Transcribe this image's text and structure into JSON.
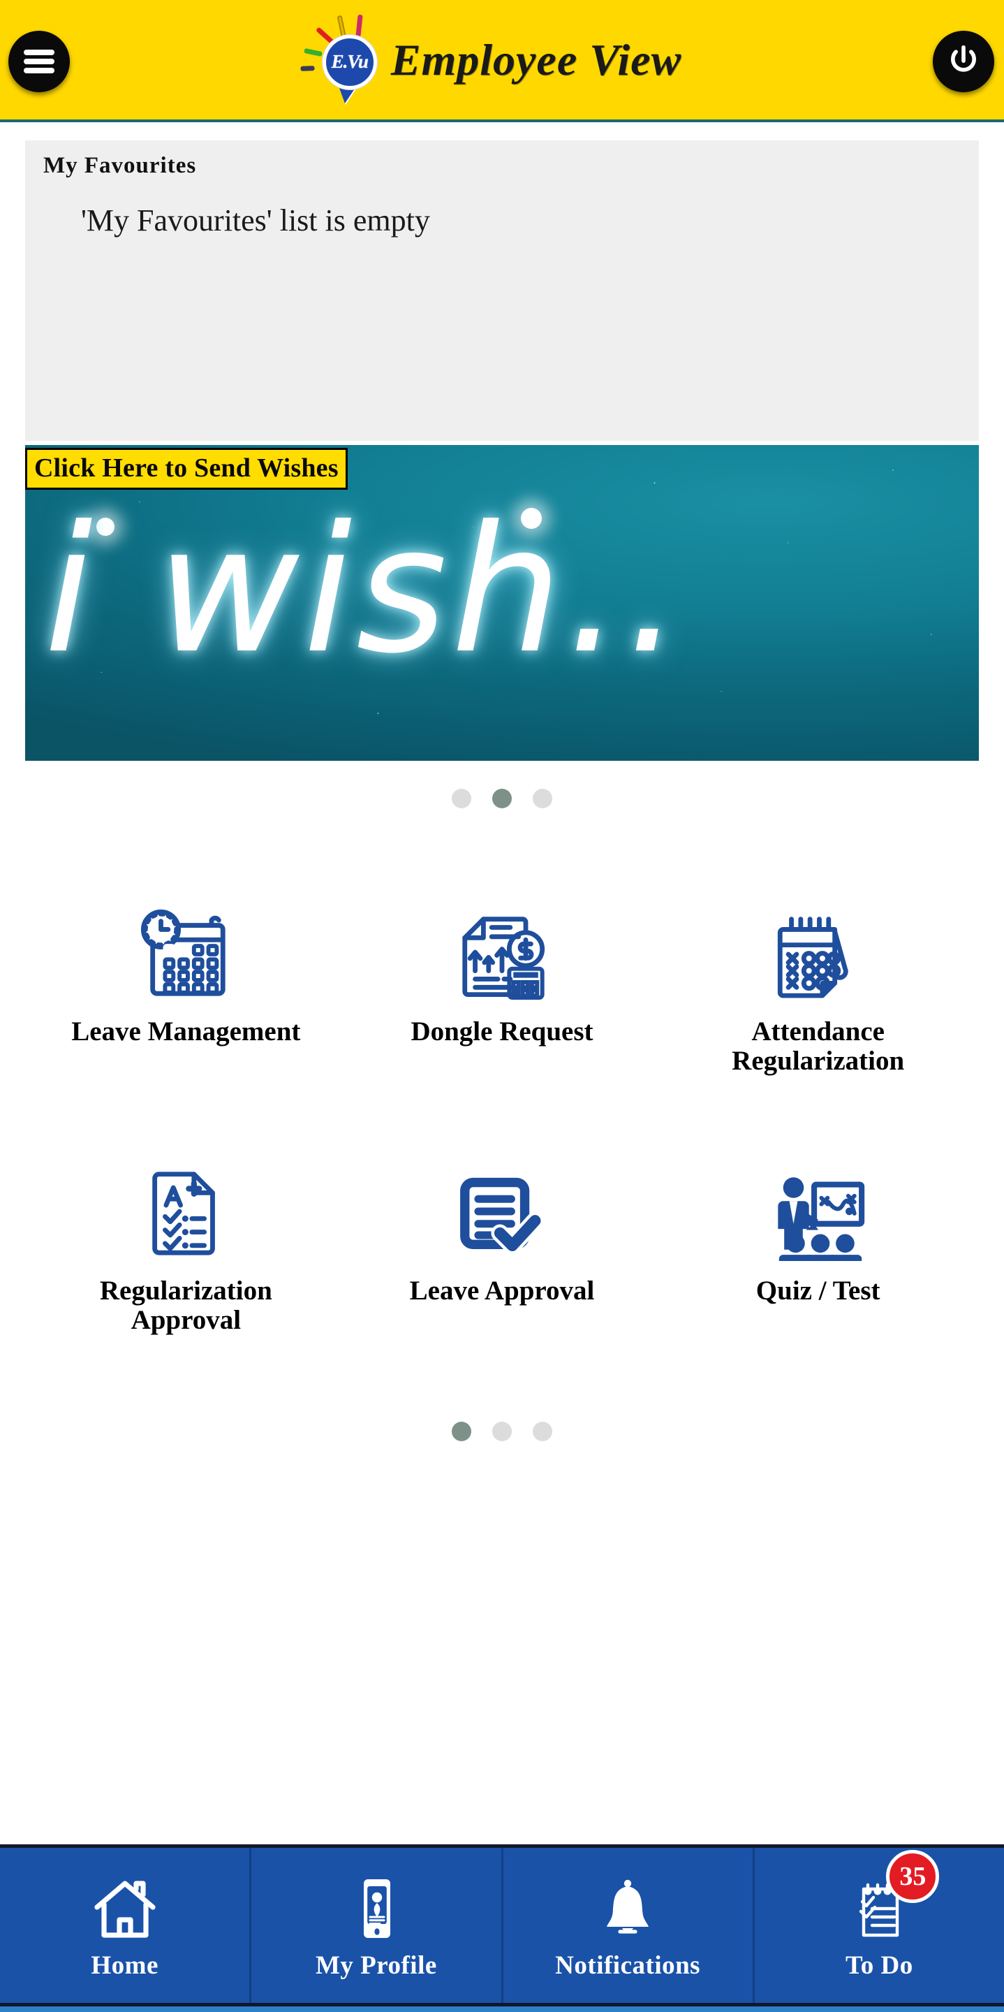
{
  "header": {
    "title": "Employee View",
    "logo_text": "E.Vu",
    "menu_icon": "hamburger-menu-icon",
    "power_icon": "power-icon",
    "bg_color": "#FFD800"
  },
  "favourites": {
    "title": "My Favourites",
    "empty_message": "'My Favourites' list is empty"
  },
  "wishes_banner": {
    "button_label": "Click Here to Send Wishes",
    "banner_text": "i wish..",
    "button_bg": "#FFDD00",
    "banner_bg": "#127e93"
  },
  "carousel_top": {
    "dots": 3,
    "active_index": 1
  },
  "apps": {
    "items": [
      {
        "label": "Leave Management",
        "icon": "calendar-clock-icon"
      },
      {
        "label": "Dongle Request",
        "icon": "document-money-calculator-icon"
      },
      {
        "label": "Attendance Regularization",
        "icon": "spiral-calendar-xo-icon"
      },
      {
        "label": "Regularization Approval",
        "icon": "grade-report-checklist-icon"
      },
      {
        "label": "Leave Approval",
        "icon": "document-checkmark-icon"
      },
      {
        "label": "Quiz / Test",
        "icon": "presenter-whiteboard-icon"
      }
    ],
    "icon_color": "#1f4e9c"
  },
  "carousel_apps": {
    "dots": 3,
    "active_index": 0
  },
  "bottom_nav": {
    "bg_color": "#1a52a8",
    "items": [
      {
        "label": "Home",
        "icon": "home-icon",
        "badge": null
      },
      {
        "label": "My Profile",
        "icon": "profile-phone-icon",
        "badge": null
      },
      {
        "label": "Notifications",
        "icon": "bell-icon",
        "badge": null
      },
      {
        "label": "To Do",
        "icon": "clipboard-checklist-icon",
        "badge": "35"
      }
    ],
    "badge_color": "#e31b23"
  }
}
